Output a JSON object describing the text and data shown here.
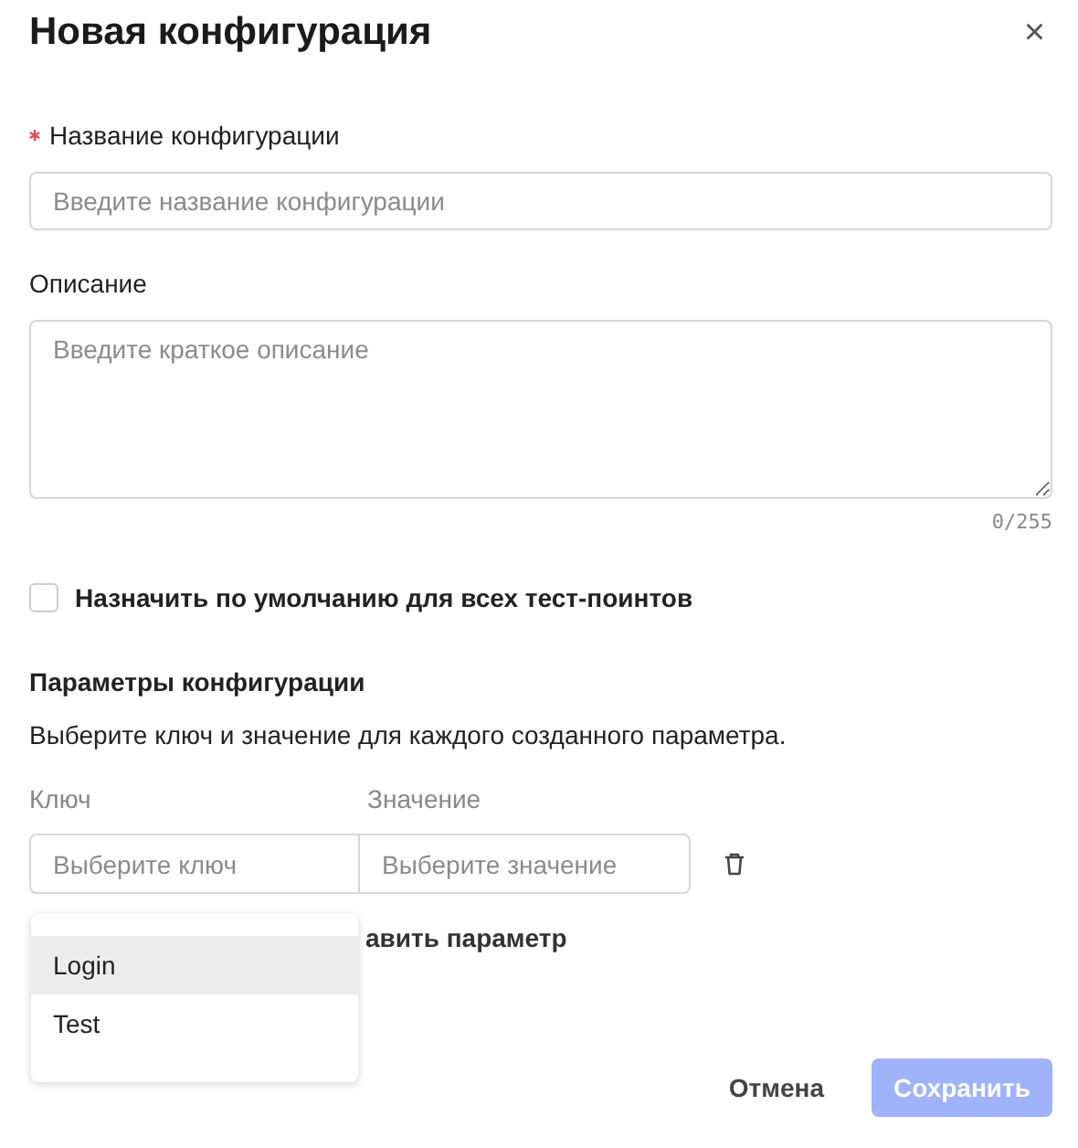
{
  "dialog": {
    "title": "Новая конфигурация",
    "close": "×"
  },
  "name_field": {
    "label": "Название конфигурации",
    "required": true,
    "placeholder": "Введите название конфигурации"
  },
  "description_field": {
    "label": "Описание",
    "placeholder": "Введите краткое описание",
    "counter": "0/255"
  },
  "default_checkbox": {
    "label": "Назначить по умолчанию для всех тест-поинтов",
    "checked": false
  },
  "parameters": {
    "title": "Параметры конфигурации",
    "hint": "Выберите ключ и значение для каждого созданного параметра.",
    "key_label": "Ключ",
    "value_label": "Значение",
    "rows": [
      {
        "key_placeholder": "Выберите ключ",
        "value_placeholder": "Выберите значение"
      }
    ],
    "add_link": "авить параметр",
    "key_dropdown": [
      {
        "label": "Login",
        "selected": true
      },
      {
        "label": "Test",
        "selected": false
      }
    ]
  },
  "buttons": [
    {
      "label": "Отмена",
      "kind": "text",
      "disabled": false
    },
    {
      "label": "Сохранить",
      "kind": "primary",
      "disabled": true
    }
  ]
}
